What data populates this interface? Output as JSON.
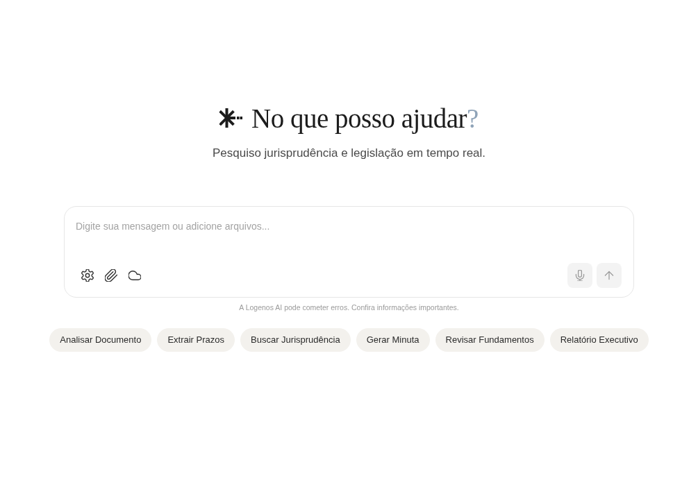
{
  "hero": {
    "title": "No que posso ajudar",
    "title_accent": "?",
    "subtitle": "Pesquiso jurisprudência e legislação em tempo real."
  },
  "composer": {
    "placeholder": "Digite sua mensagem ou adicione arquivos...",
    "tools": [
      {
        "kind": "settings"
      },
      {
        "kind": "attach"
      },
      {
        "kind": "cloud"
      }
    ],
    "actions": [
      {
        "kind": "mic"
      },
      {
        "kind": "send"
      }
    ]
  },
  "disclaimer": "A Logenos AI pode cometer erros. Confira informações importantes.",
  "suggestions": [
    "Analisar Documento",
    "Extrair Prazos",
    "Buscar Jurisprudência",
    "Gerar Minuta",
    "Revisar Fundamentos",
    "Relatório Executivo"
  ]
}
